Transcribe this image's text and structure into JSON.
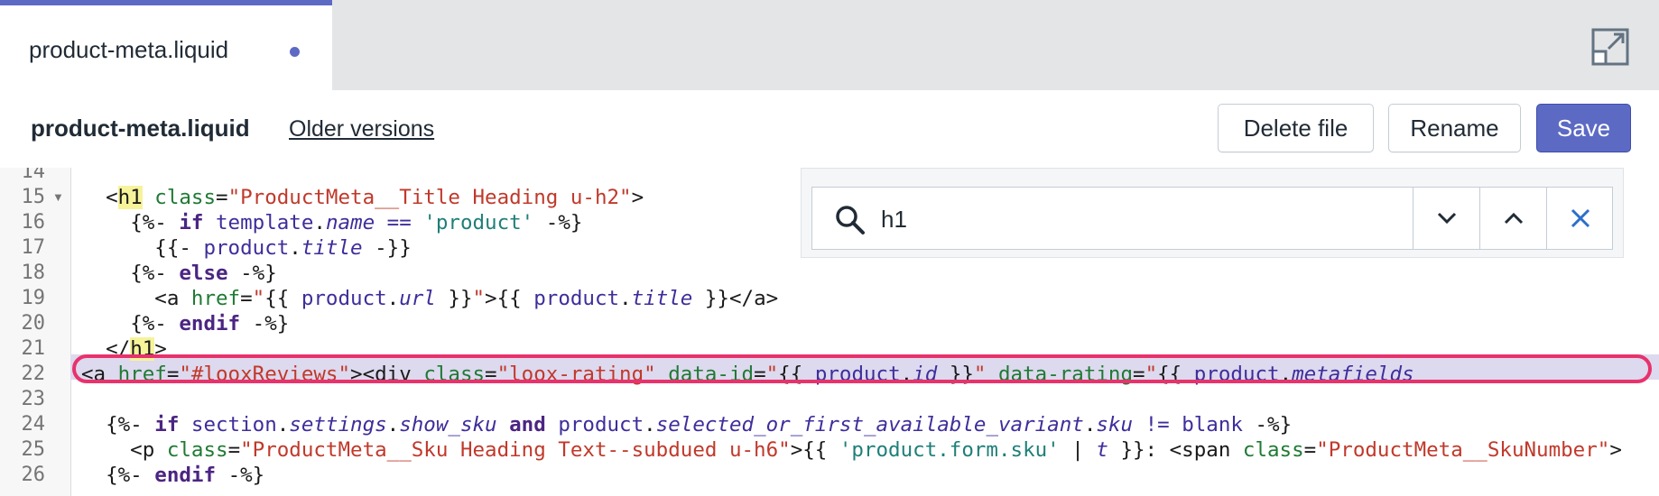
{
  "tab": {
    "label": "product-meta.liquid"
  },
  "header": {
    "file_title": "product-meta.liquid",
    "older_versions": "Older versions",
    "delete_label": "Delete file",
    "rename_label": "Rename",
    "save_label": "Save"
  },
  "search": {
    "value": "h1"
  },
  "colors": {
    "accent": "#5c6ac4",
    "highlight_ring": "#e8326c"
  },
  "editor": {
    "line_numbers": [
      "14",
      "15",
      "16",
      "17",
      "18",
      "19",
      "20",
      "21",
      "22",
      "23",
      "24",
      "25",
      "26"
    ]
  }
}
